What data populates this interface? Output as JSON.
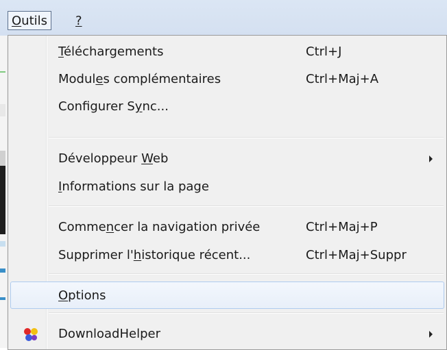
{
  "menubar": {
    "outils": {
      "underlined": "O",
      "rest": "utils"
    },
    "help": {
      "underlined": "?"
    }
  },
  "menu": {
    "items": [
      {
        "pre": "",
        "u": "T",
        "post": "éléchargements",
        "shortcut": "Ctrl+J"
      },
      {
        "pre": "Modul",
        "u": "e",
        "post": "s complémentaires",
        "shortcut": "Ctrl+Maj+A"
      },
      {
        "pre": "Configurer S",
        "u": "y",
        "post": "nc...",
        "shortcut": ""
      },
      {
        "pre": "Développeur ",
        "u": "W",
        "post": "eb",
        "shortcut": ""
      },
      {
        "pre": "",
        "u": "I",
        "post": "nformations sur la page",
        "shortcut": ""
      },
      {
        "pre": "Comme",
        "u": "n",
        "post": "cer la navigation privée",
        "shortcut": "Ctrl+Maj+P"
      },
      {
        "pre": "Supprimer l'",
        "u": "h",
        "post": "istorique récent...",
        "shortcut": "Ctrl+Maj+Suppr"
      },
      {
        "pre": "",
        "u": "O",
        "post": "ptions",
        "shortcut": ""
      },
      {
        "pre": "DownloadHelper",
        "u": "",
        "post": "",
        "shortcut": ""
      }
    ]
  },
  "icons": {
    "submenu": "chevron-right-icon",
    "downloadhelper": "downloadhelper-icon"
  },
  "colors": {
    "menubar_bg": "#d4e0f1",
    "menu_bg": "#f0f0f0",
    "highlight_border": "#aecbef"
  }
}
